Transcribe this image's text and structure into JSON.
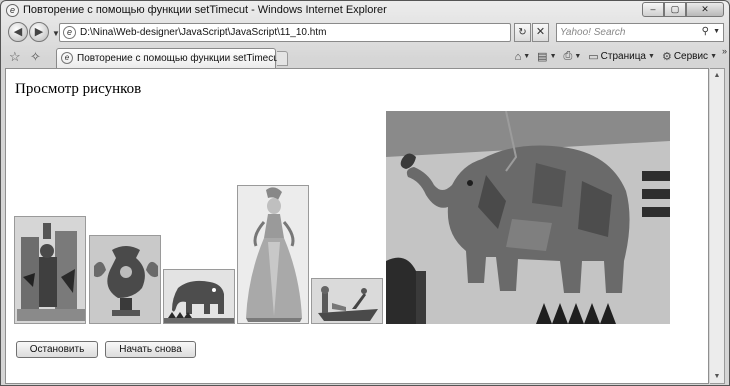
{
  "window": {
    "title": "Повторение с помощью функции setTimecut - Windows Internet Explorer",
    "controls": {
      "minimize": "–",
      "maximize": "▢",
      "close": "✕"
    }
  },
  "navigation": {
    "address": "D:\\Nina\\Web-designer\\JavaScript\\JavaScript\\11_10.htm",
    "search_placeholder": "Yahoo! Search"
  },
  "tabs": [
    {
      "label": "Повторение с помощью функции setTimecut"
    }
  ],
  "toolbar": {
    "page_label": "Страница",
    "tools_label": "Сервис"
  },
  "page": {
    "heading": "Просмотр рисунков",
    "images": [
      {
        "subject": "heraldic figures"
      },
      {
        "subject": "ornamental vase"
      },
      {
        "subject": "small elephant"
      },
      {
        "subject": "lady in gown"
      },
      {
        "subject": "figure in boat"
      },
      {
        "subject": "elephant mosaic"
      }
    ],
    "buttons": {
      "stop": "Остановить",
      "restart": "Начать снова"
    }
  },
  "colors": {
    "chrome": "#d5d5d5",
    "content_bg": "#ffffff",
    "elephant_fill": "#6a6a6a",
    "mosaic_wall": "#c4c4c4"
  }
}
